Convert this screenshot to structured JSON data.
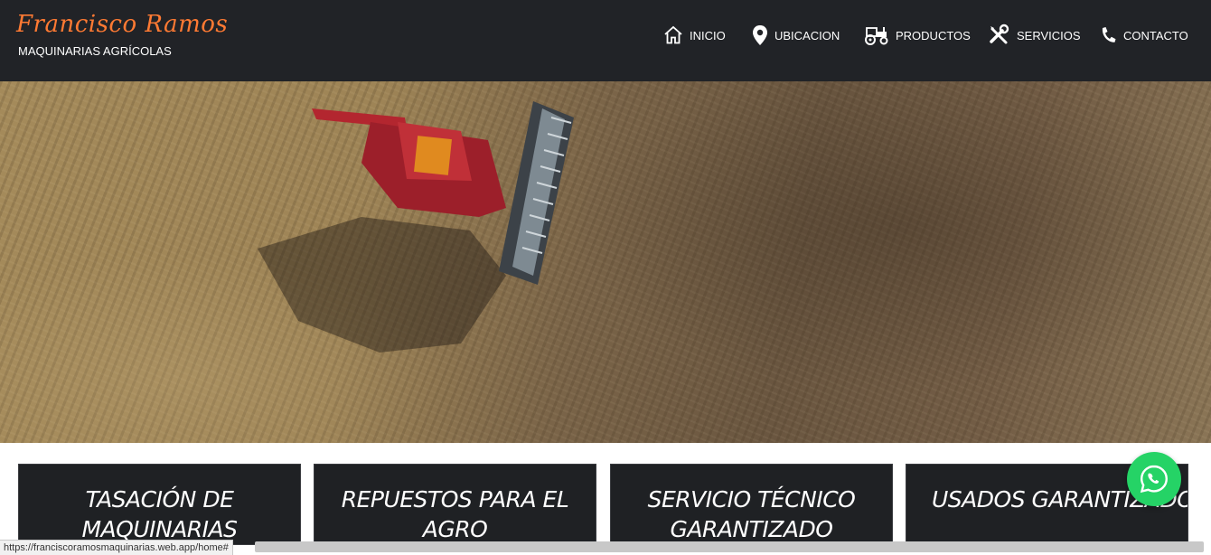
{
  "brand": {
    "name": "Francisco Ramos",
    "tagline": "MAQUINARIAS AGRÍCOLAS",
    "accent_color": "#ff7a33"
  },
  "nav": [
    {
      "label": "INICIO",
      "icon": "home-icon"
    },
    {
      "label": "UBICACION",
      "icon": "map-pin-icon"
    },
    {
      "label": "PRODUCTOS",
      "icon": "tractor-icon"
    },
    {
      "label": "SERVICIOS",
      "icon": "tools-icon"
    },
    {
      "label": "CONTACTO",
      "icon": "phone-icon"
    }
  ],
  "hero": {
    "image_subject": "aerial-combine-harvester-field"
  },
  "cards": [
    {
      "line1": "TASACIÓN DE",
      "line2": "MAQUINARIAS"
    },
    {
      "line1": "REPUESTOS PARA EL",
      "line2": "AGRO"
    },
    {
      "line1": "SERVICIO TÉCNICO",
      "line2": "GARANTIZADO"
    },
    {
      "line1": "USADOS GARANTIZADOS",
      "line2": ""
    }
  ],
  "whatsapp": {
    "icon": "whatsapp-icon",
    "color": "#25d366"
  },
  "status_bar": {
    "url": "https://franciscoramosmaquinarias.web.app/home#"
  },
  "colors": {
    "header_bg": "#212327",
    "card_bg": "#1f2124"
  }
}
